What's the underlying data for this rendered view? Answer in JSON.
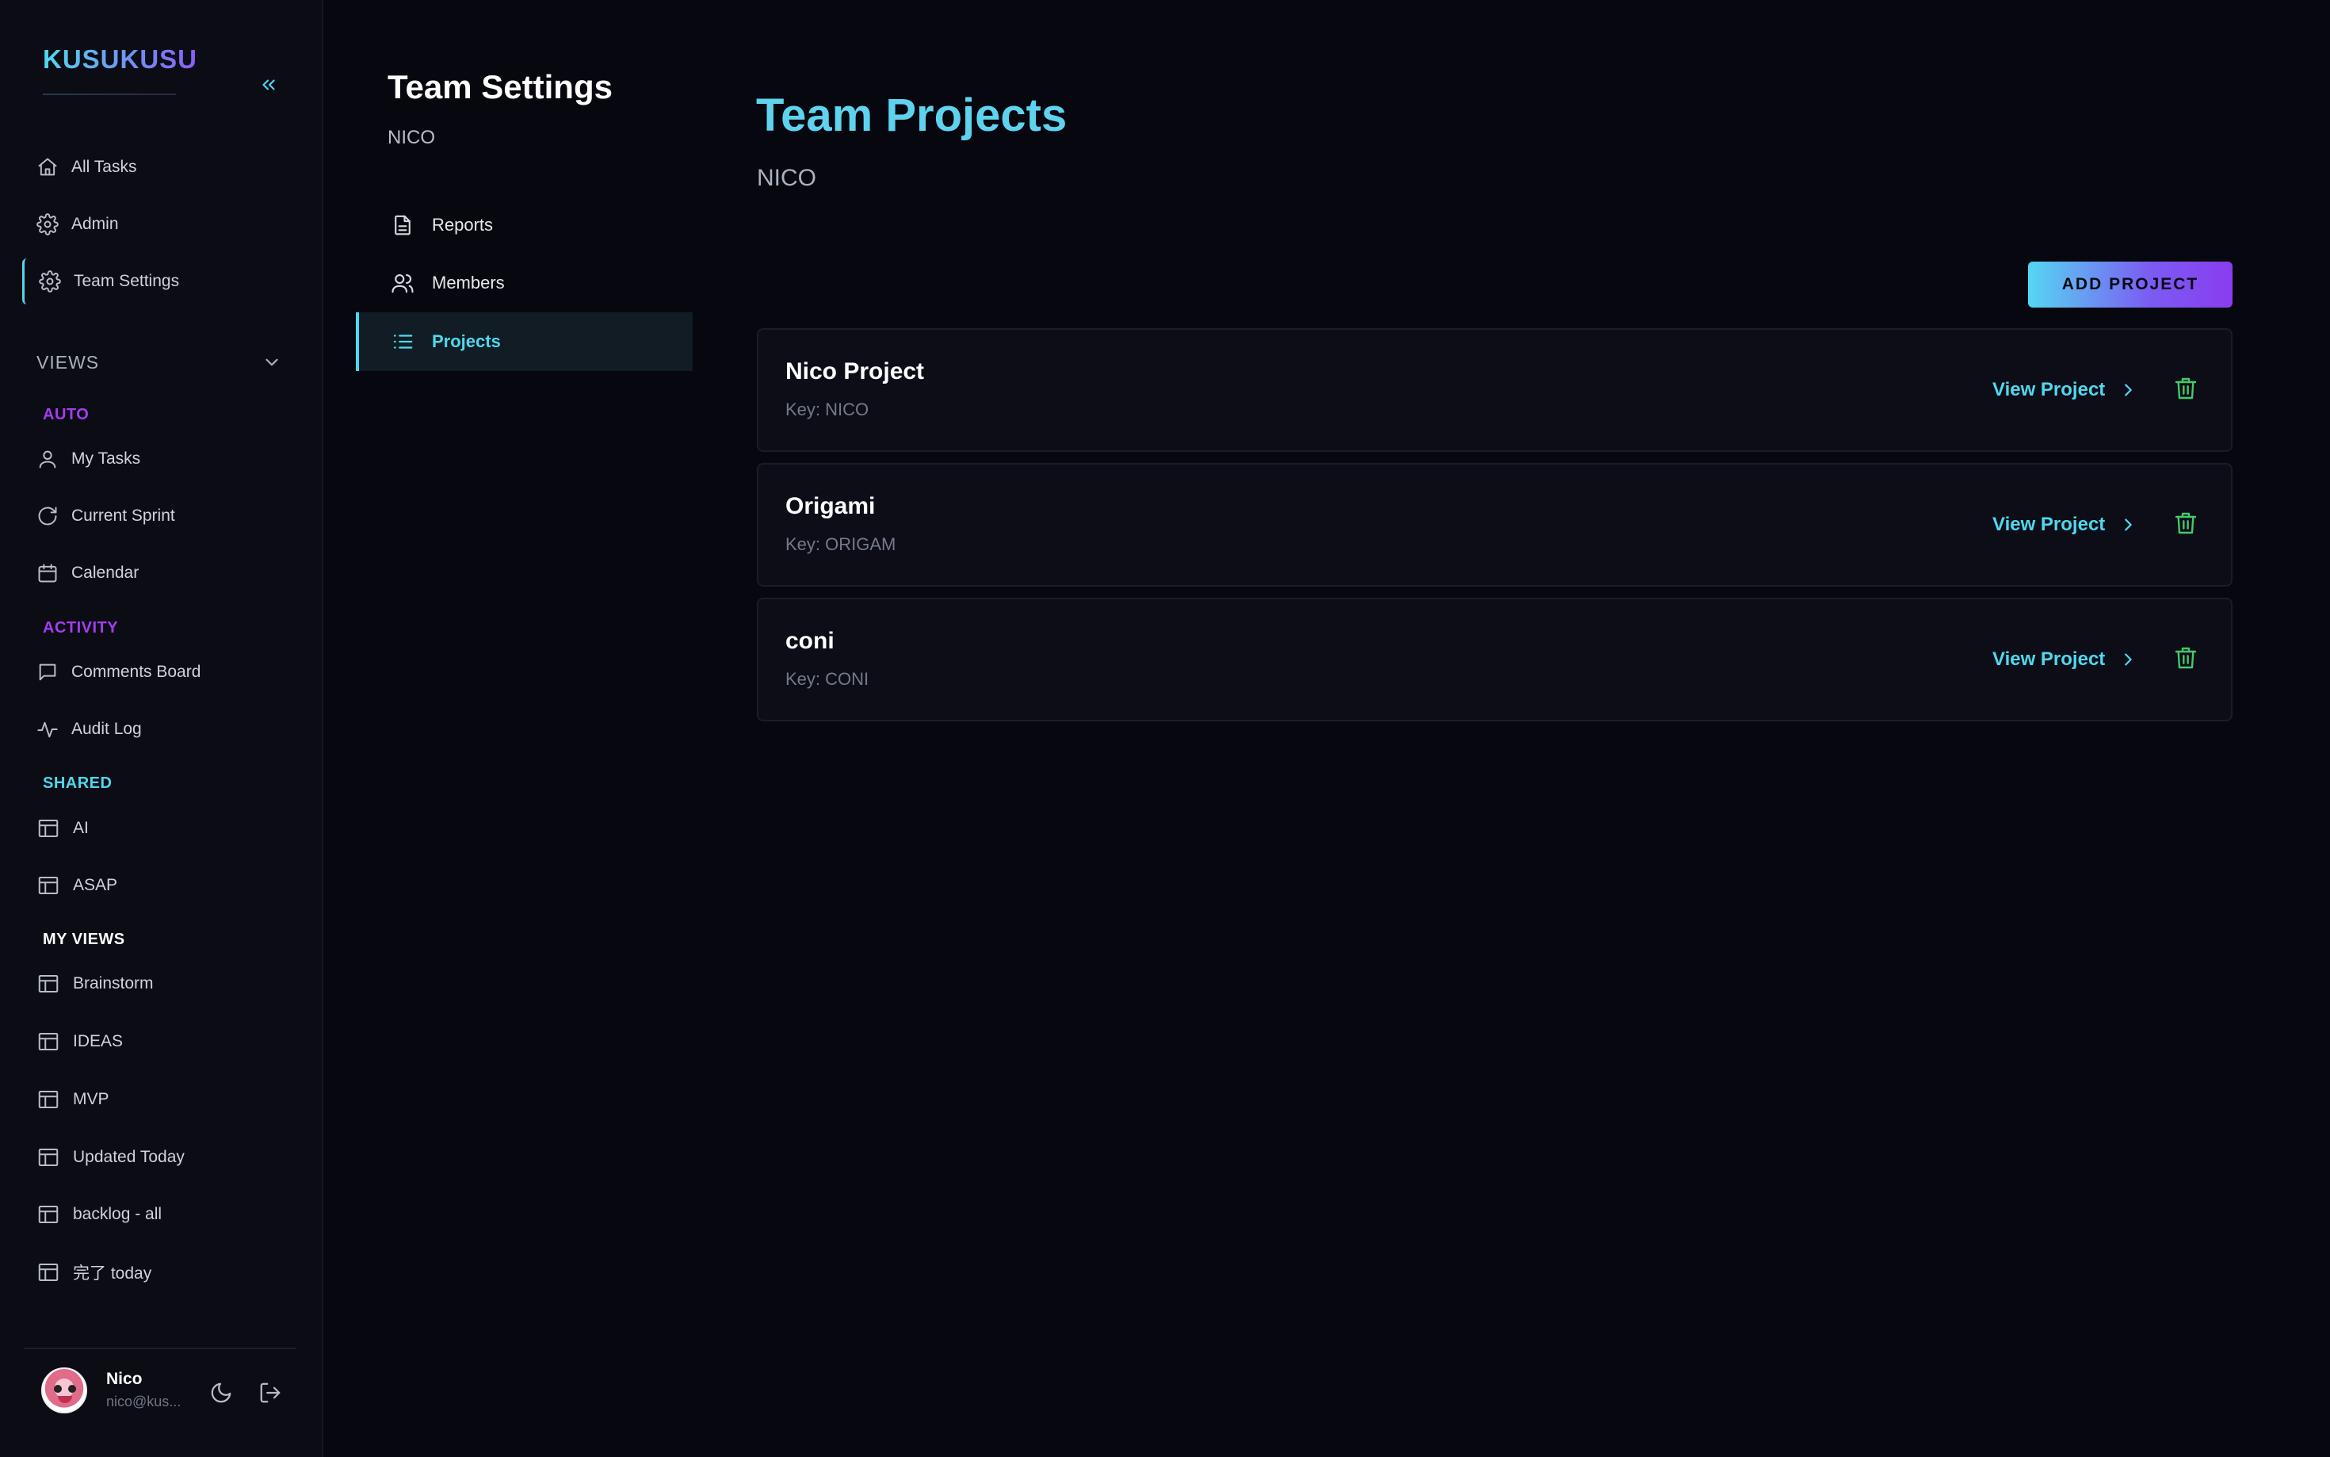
{
  "brand": "KUSUKUSU",
  "sidebar": {
    "nav": [
      {
        "label": "All Tasks",
        "icon": "home-icon"
      },
      {
        "label": "Admin",
        "icon": "gear-icon"
      },
      {
        "label": "Team Settings",
        "icon": "gear-icon"
      }
    ],
    "views_label": "VIEWS",
    "groups": {
      "auto": {
        "label": "AUTO",
        "color": "#a43cf0",
        "items": [
          "My Tasks",
          "Current Sprint",
          "Calendar"
        ]
      },
      "activity": {
        "label": "ACTIVITY",
        "color": "#a43cf0",
        "items": [
          "Comments Board",
          "Audit Log"
        ]
      },
      "shared": {
        "label": "SHARED",
        "color": "#4fd8ee",
        "items": [
          "AI",
          "ASAP"
        ]
      },
      "my_views": {
        "label": "MY VIEWS",
        "color": "#ffffff",
        "items": [
          "Brainstorm",
          "IDEAS",
          "MVP",
          "Updated Today",
          "backlog - all",
          "完了 today"
        ]
      }
    },
    "user": {
      "name": "Nico",
      "email": "nico@kus..."
    }
  },
  "settings": {
    "title": "Team Settings",
    "team": "NICO",
    "items": [
      {
        "label": "Reports",
        "icon": "document-icon"
      },
      {
        "label": "Members",
        "icon": "users-icon"
      },
      {
        "label": "Projects",
        "icon": "list-icon"
      }
    ]
  },
  "main": {
    "title": "Team Projects",
    "team": "NICO",
    "add_button": "ADD PROJECT",
    "view_label": "View Project",
    "projects": [
      {
        "name": "Nico Project",
        "key": "Key: NICO"
      },
      {
        "name": "Origami",
        "key": "Key: ORIGAM"
      },
      {
        "name": "coni",
        "key": "Key: CONI"
      }
    ]
  },
  "colors": {
    "accent": "#4fd8ee",
    "purple": "#8a3cf0",
    "delete": "#46c86a",
    "background": "#07080f"
  }
}
